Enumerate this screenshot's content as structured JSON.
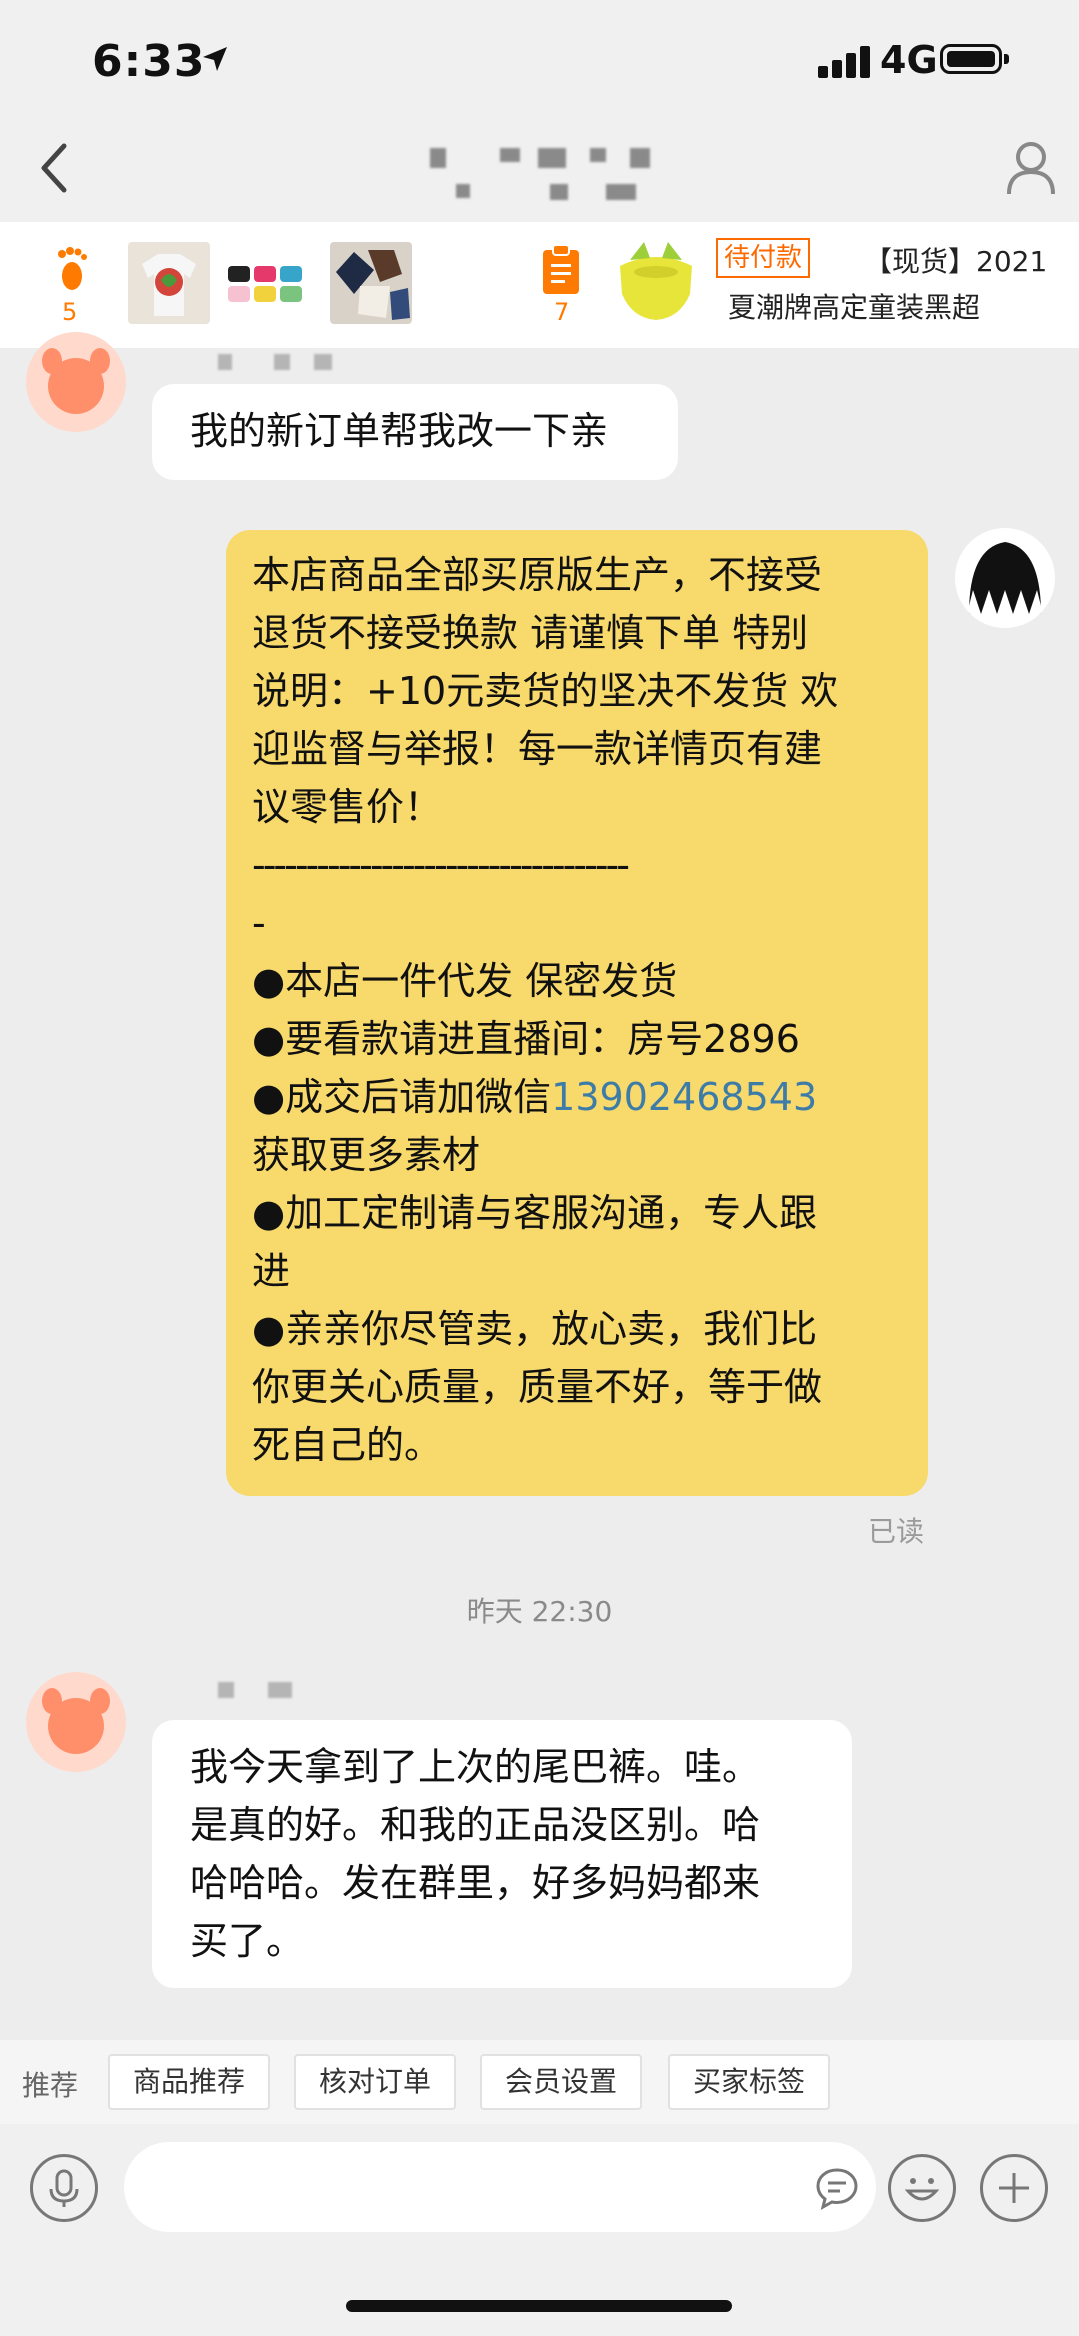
{
  "status_bar": {
    "time": "6:33",
    "network": "4G"
  },
  "header": {
    "back_icon": "chevron-left-icon",
    "profile_icon": "person-icon"
  },
  "product_strip": {
    "footprint_count": "5",
    "orders_count": "7",
    "status_badge": "待付款",
    "title_line1": "【现货】2021",
    "title_line2": "夏潮牌高定童装黑超",
    "accent_color": "#ff6a00"
  },
  "messages": [
    {
      "id": "m1",
      "side": "left",
      "text": "我的新订单帮我改一下亲"
    },
    {
      "id": "m2",
      "side": "right",
      "lines": [
        "本店商品全部买原版生产，不接受",
        "退货不接受换款 请谨慎下单 特别",
        "说明：+10元卖货的坚决不发货 欢",
        "迎监督与举报！每一款详情页有建",
        "议零售价！",
        "-----------------------------------",
        "-",
        "●本店一件代发 保密发货",
        "●要看款请进直播间：房号2896",
        "●成交后请加微信",
        "获取更多素材",
        "●加工定制请与客服沟通，专人跟",
        "进",
        "●亲亲你尽管卖，放心卖，我们比",
        "你更关心质量，质量不好，等于做",
        "死自己的。"
      ],
      "phone": "13902468543",
      "read_receipt": "已读",
      "bubble_color": "#f8d96b"
    },
    {
      "id": "m3",
      "side": "left",
      "timestamp": "昨天 22:30",
      "lines": [
        "我今天拿到了上次的尾巴裤。哇。",
        "是真的好。和我的正品没区别。哈",
        "哈哈哈。发在群里，好多妈妈都来",
        "买了。"
      ]
    }
  ],
  "shortcuts": {
    "label": "推荐",
    "items": [
      "商品推荐",
      "核对订单",
      "会员设置",
      "买家标签"
    ]
  },
  "input_bar": {
    "voice_icon": "microphone-icon",
    "quick_reply_icon": "chat-bubble-icon",
    "emoji_icon": "smiley-icon",
    "plus_icon": "plus-icon"
  }
}
